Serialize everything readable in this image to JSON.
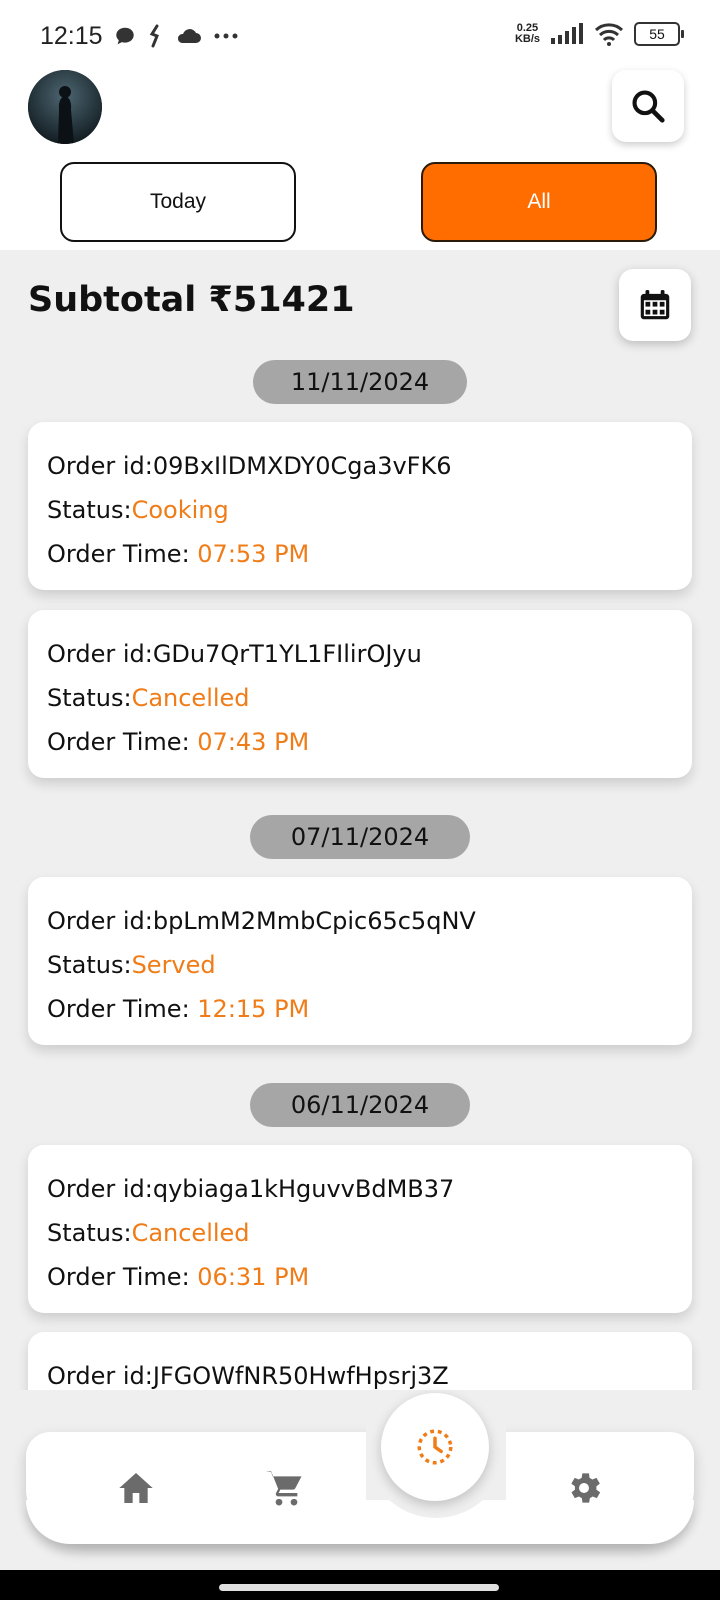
{
  "status_bar": {
    "time": "12:15",
    "icons": [
      "chat-icon",
      "notification-icon",
      "cloud-icon",
      "more-dots"
    ],
    "net_speed_value": "0.25",
    "net_speed_unit": "KB/s",
    "battery": "55"
  },
  "tabs": {
    "today_label": "Today",
    "all_label": "All",
    "active": "All"
  },
  "subtotal": {
    "label": "Subtotal ₹51421"
  },
  "labels": {
    "order_id_prefix": "Order id:",
    "status_prefix": "Status:",
    "time_prefix": "Order Time: "
  },
  "groups": [
    {
      "date": "11/11/2024",
      "orders": [
        {
          "id": "09BxIlDMXDY0Cga3vFK6",
          "status": "Cooking",
          "time": "07:53 PM"
        },
        {
          "id": "GDu7QrT1YL1FIlirOJyu",
          "status": "Cancelled",
          "time": "07:43 PM"
        }
      ]
    },
    {
      "date": "07/11/2024",
      "orders": [
        {
          "id": "bpLmM2MmbCpic65c5qNV",
          "status": "Served",
          "time": "12:15 PM"
        }
      ]
    },
    {
      "date": "06/11/2024",
      "orders": [
        {
          "id": "qybiaga1kHguvvBdMB37",
          "status": "Cancelled",
          "time": "06:31 PM"
        },
        {
          "id": "JFGOWfNR50HwfHpsrj3Z"
        }
      ]
    }
  ],
  "bottom_nav": {
    "items": [
      "home-icon",
      "cart-icon",
      "history-icon",
      "settings-icon"
    ],
    "active": "history-icon"
  },
  "colors": {
    "accent": "#ff6d00",
    "status_text": "#f07c18",
    "background": "#efefef",
    "chip": "#a6a6a6"
  }
}
